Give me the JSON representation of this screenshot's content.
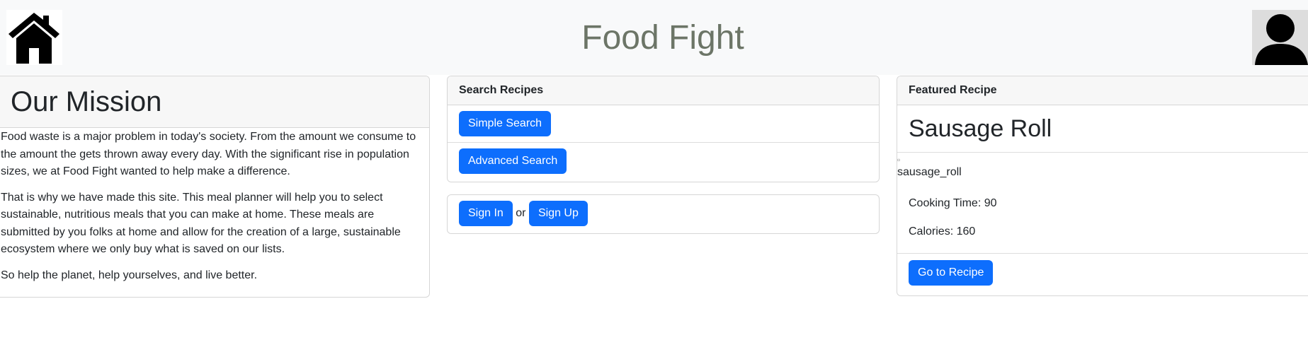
{
  "header": {
    "title": "Food Fight"
  },
  "mission": {
    "title": "Our Mission",
    "paragraphs": [
      "Food waste is a major problem in today's society. From the amount we consume to the amount the gets thrown away every day. With the significant rise in population sizes, we at Food Fight wanted to help make a difference.",
      "That is why we have made this site. This meal planner will help you to select sustainable, nutritious meals that you can make at home. These meals are submitted by you folks at home and allow for the creation of a large, sustainable ecosystem where we only buy what is saved on our lists.",
      "So help the planet, help yourselves, and live better."
    ]
  },
  "search": {
    "header": "Search Recipes",
    "simple": "Simple Search",
    "advanced": "Advanced Search"
  },
  "auth": {
    "sign_in": "Sign In",
    "or": "or",
    "sign_up": "Sign Up"
  },
  "featured": {
    "header": "Featured Recipe",
    "name": "Sausage Roll",
    "image_alt": "sausage_roll",
    "cooking_time": "Cooking Time: 90",
    "calories": "Calories: 160",
    "go": "Go to Recipe"
  }
}
